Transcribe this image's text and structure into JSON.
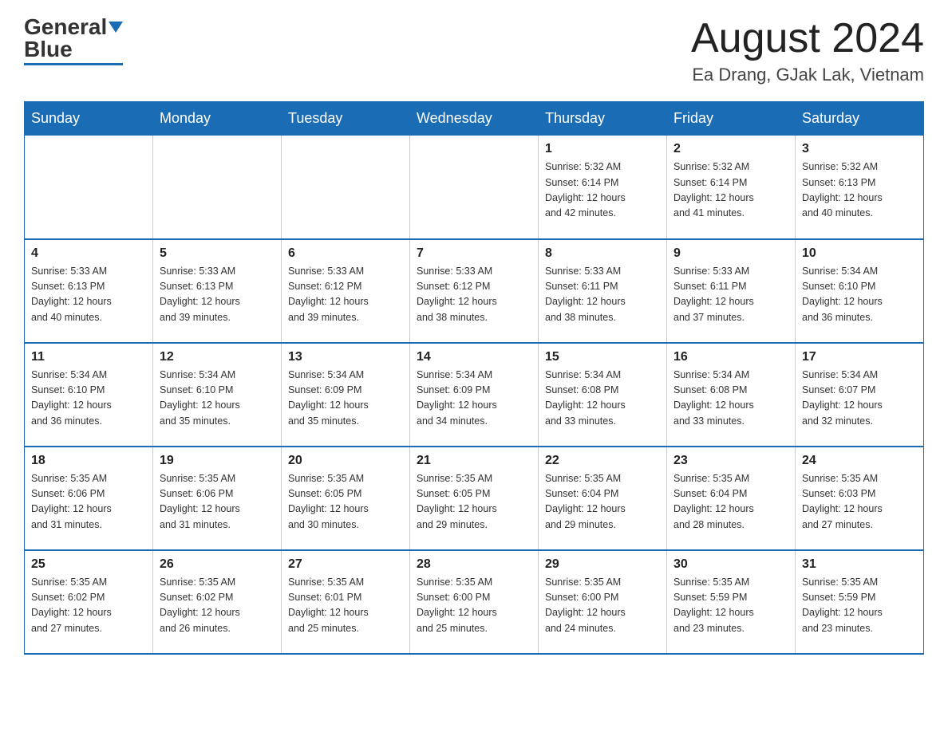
{
  "header": {
    "logo_general": "General",
    "logo_blue": "Blue",
    "month_title": "August 2024",
    "location": "Ea Drang, GJak Lak, Vietnam"
  },
  "days_of_week": [
    "Sunday",
    "Monday",
    "Tuesday",
    "Wednesday",
    "Thursday",
    "Friday",
    "Saturday"
  ],
  "weeks": [
    [
      {
        "day": "",
        "info": ""
      },
      {
        "day": "",
        "info": ""
      },
      {
        "day": "",
        "info": ""
      },
      {
        "day": "",
        "info": ""
      },
      {
        "day": "1",
        "info": "Sunrise: 5:32 AM\nSunset: 6:14 PM\nDaylight: 12 hours\nand 42 minutes."
      },
      {
        "day": "2",
        "info": "Sunrise: 5:32 AM\nSunset: 6:14 PM\nDaylight: 12 hours\nand 41 minutes."
      },
      {
        "day": "3",
        "info": "Sunrise: 5:32 AM\nSunset: 6:13 PM\nDaylight: 12 hours\nand 40 minutes."
      }
    ],
    [
      {
        "day": "4",
        "info": "Sunrise: 5:33 AM\nSunset: 6:13 PM\nDaylight: 12 hours\nand 40 minutes."
      },
      {
        "day": "5",
        "info": "Sunrise: 5:33 AM\nSunset: 6:13 PM\nDaylight: 12 hours\nand 39 minutes."
      },
      {
        "day": "6",
        "info": "Sunrise: 5:33 AM\nSunset: 6:12 PM\nDaylight: 12 hours\nand 39 minutes."
      },
      {
        "day": "7",
        "info": "Sunrise: 5:33 AM\nSunset: 6:12 PM\nDaylight: 12 hours\nand 38 minutes."
      },
      {
        "day": "8",
        "info": "Sunrise: 5:33 AM\nSunset: 6:11 PM\nDaylight: 12 hours\nand 38 minutes."
      },
      {
        "day": "9",
        "info": "Sunrise: 5:33 AM\nSunset: 6:11 PM\nDaylight: 12 hours\nand 37 minutes."
      },
      {
        "day": "10",
        "info": "Sunrise: 5:34 AM\nSunset: 6:10 PM\nDaylight: 12 hours\nand 36 minutes."
      }
    ],
    [
      {
        "day": "11",
        "info": "Sunrise: 5:34 AM\nSunset: 6:10 PM\nDaylight: 12 hours\nand 36 minutes."
      },
      {
        "day": "12",
        "info": "Sunrise: 5:34 AM\nSunset: 6:10 PM\nDaylight: 12 hours\nand 35 minutes."
      },
      {
        "day": "13",
        "info": "Sunrise: 5:34 AM\nSunset: 6:09 PM\nDaylight: 12 hours\nand 35 minutes."
      },
      {
        "day": "14",
        "info": "Sunrise: 5:34 AM\nSunset: 6:09 PM\nDaylight: 12 hours\nand 34 minutes."
      },
      {
        "day": "15",
        "info": "Sunrise: 5:34 AM\nSunset: 6:08 PM\nDaylight: 12 hours\nand 33 minutes."
      },
      {
        "day": "16",
        "info": "Sunrise: 5:34 AM\nSunset: 6:08 PM\nDaylight: 12 hours\nand 33 minutes."
      },
      {
        "day": "17",
        "info": "Sunrise: 5:34 AM\nSunset: 6:07 PM\nDaylight: 12 hours\nand 32 minutes."
      }
    ],
    [
      {
        "day": "18",
        "info": "Sunrise: 5:35 AM\nSunset: 6:06 PM\nDaylight: 12 hours\nand 31 minutes."
      },
      {
        "day": "19",
        "info": "Sunrise: 5:35 AM\nSunset: 6:06 PM\nDaylight: 12 hours\nand 31 minutes."
      },
      {
        "day": "20",
        "info": "Sunrise: 5:35 AM\nSunset: 6:05 PM\nDaylight: 12 hours\nand 30 minutes."
      },
      {
        "day": "21",
        "info": "Sunrise: 5:35 AM\nSunset: 6:05 PM\nDaylight: 12 hours\nand 29 minutes."
      },
      {
        "day": "22",
        "info": "Sunrise: 5:35 AM\nSunset: 6:04 PM\nDaylight: 12 hours\nand 29 minutes."
      },
      {
        "day": "23",
        "info": "Sunrise: 5:35 AM\nSunset: 6:04 PM\nDaylight: 12 hours\nand 28 minutes."
      },
      {
        "day": "24",
        "info": "Sunrise: 5:35 AM\nSunset: 6:03 PM\nDaylight: 12 hours\nand 27 minutes."
      }
    ],
    [
      {
        "day": "25",
        "info": "Sunrise: 5:35 AM\nSunset: 6:02 PM\nDaylight: 12 hours\nand 27 minutes."
      },
      {
        "day": "26",
        "info": "Sunrise: 5:35 AM\nSunset: 6:02 PM\nDaylight: 12 hours\nand 26 minutes."
      },
      {
        "day": "27",
        "info": "Sunrise: 5:35 AM\nSunset: 6:01 PM\nDaylight: 12 hours\nand 25 minutes."
      },
      {
        "day": "28",
        "info": "Sunrise: 5:35 AM\nSunset: 6:00 PM\nDaylight: 12 hours\nand 25 minutes."
      },
      {
        "day": "29",
        "info": "Sunrise: 5:35 AM\nSunset: 6:00 PM\nDaylight: 12 hours\nand 24 minutes."
      },
      {
        "day": "30",
        "info": "Sunrise: 5:35 AM\nSunset: 5:59 PM\nDaylight: 12 hours\nand 23 minutes."
      },
      {
        "day": "31",
        "info": "Sunrise: 5:35 AM\nSunset: 5:59 PM\nDaylight: 12 hours\nand 23 minutes."
      }
    ]
  ]
}
